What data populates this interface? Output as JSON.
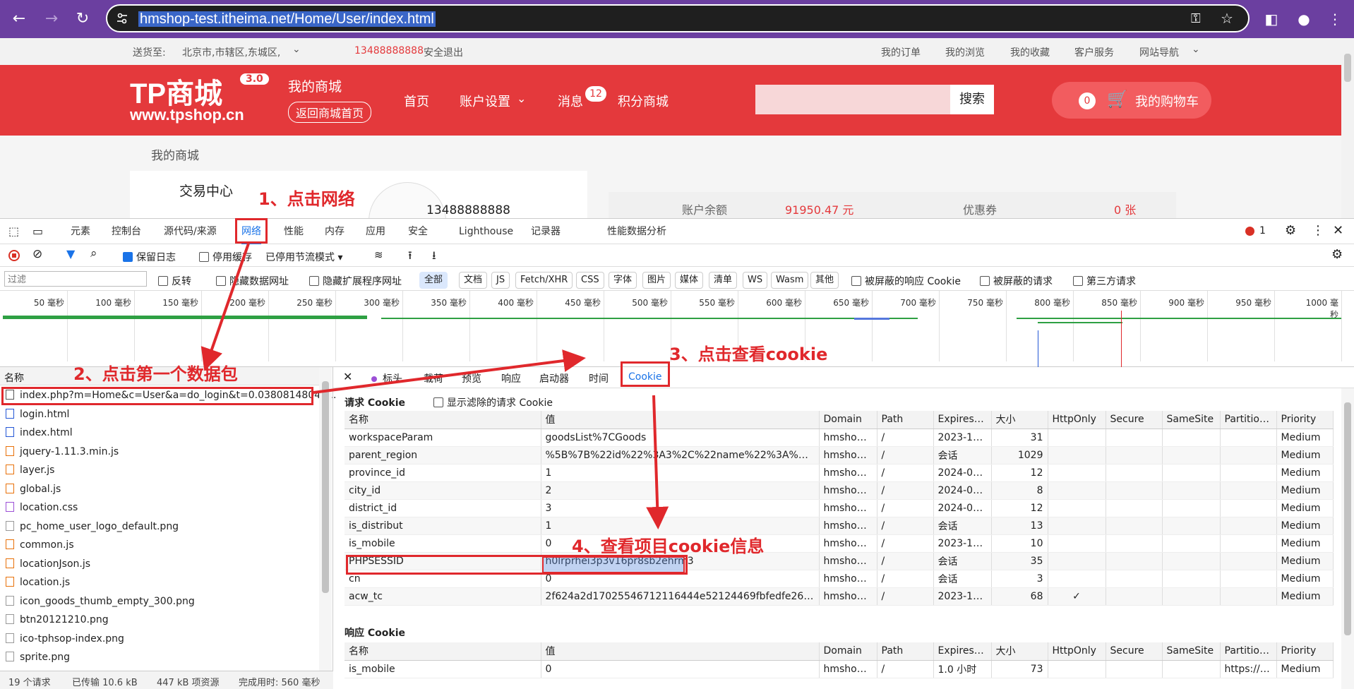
{
  "browser": {
    "url": "hmshop-test.itheima.net/Home/User/index.html"
  },
  "topbar": {
    "ship_to_label": "送货至:",
    "ship_to_value": "北京市,市辖区,东城区,",
    "phone": "13488888888",
    "logout": "安全退出",
    "links": [
      "我的订单",
      "我的浏览",
      "我的收藏",
      "客户服务",
      "网站导航"
    ]
  },
  "header": {
    "logo_text": "TP商城",
    "logo_version": "3.0",
    "logo_url": "www.tpshop.cn",
    "my_mall": "我的商城",
    "back_home": "返回商城首页",
    "nav": [
      "首页",
      "账户设置",
      "消息",
      "积分商城"
    ],
    "msg_badge": "12",
    "search_button": "搜索",
    "cart_count": "0",
    "cart_label": "我的购物车"
  },
  "body": {
    "breadcrumb": "我的商城",
    "trade_center": "交易中心",
    "username": "13488888888",
    "balance_label": "账户余额",
    "balance_value": "91950.47 元",
    "coupon_label": "优惠券",
    "coupon_value": "0 张"
  },
  "devtools": {
    "tabs": [
      "元素",
      "控制台",
      "源代码/来源",
      "网络",
      "性能",
      "内存",
      "应用",
      "安全",
      "Lighthouse",
      "记录器",
      "性能数据分析"
    ],
    "error_count": "1",
    "preserve_log": "保留日志",
    "disable_cache": "停用缓存",
    "throttle": "已停用节流模式",
    "filter_placeholder": "过滤",
    "invert": "反转",
    "hide_data_urls": "隐藏数据网址",
    "hide_ext_urls": "隐藏扩展程序网址",
    "type_filters": [
      "全部",
      "文档",
      "JS",
      "Fetch/XHR",
      "CSS",
      "字体",
      "图片",
      "媒体",
      "清单",
      "WS",
      "Wasm",
      "其他"
    ],
    "blocked_cookies": "被屏蔽的响应 Cookie",
    "blocked_requests": "被屏蔽的请求",
    "third_party": "第三方请求",
    "timeline_ticks": [
      "50 毫秒",
      "100 毫秒",
      "150 毫秒",
      "200 毫秒",
      "250 毫秒",
      "300 毫秒",
      "350 毫秒",
      "400 毫秒",
      "450 毫秒",
      "500 毫秒",
      "550 毫秒",
      "600 毫秒",
      "650 毫秒",
      "700 毫秒",
      "750 毫秒",
      "800 毫秒",
      "850 毫秒",
      "900 毫秒",
      "950 毫秒",
      "1000 毫秒"
    ],
    "name_header": "名称",
    "files": [
      "index.php?m=Home&c=User&a=do_login&t=0.03808148040...",
      "login.html",
      "index.html",
      "jquery-1.11.3.min.js",
      "layer.js",
      "global.js",
      "location.css",
      "pc_home_user_logo_default.png",
      "common.js",
      "locationJson.js",
      "location.js",
      "icon_goods_thumb_empty_300.png",
      "btn20121210.png",
      "ico-tphsop-index.png",
      "sprite.png"
    ],
    "status": {
      "requests": "19 个请求",
      "transferred": "已传输 10.6 kB",
      "resources": "447 kB 项资源",
      "finish": "完成用时: 560 毫秒"
    },
    "detail_tabs": [
      "标头",
      "载荷",
      "预览",
      "响应",
      "启动器",
      "时间",
      "Cookie"
    ],
    "request_cookie_title": "请求 Cookie",
    "show_filtered": "显示滤除的请求 Cookie",
    "response_cookie_title": "响应 Cookie",
    "columns": [
      "名称",
      "值",
      "Domain",
      "Path",
      "Expires /...",
      "大小",
      "HttpOnly",
      "Secure",
      "SameSite",
      "Partition...",
      "Priority"
    ],
    "request_cookies": [
      [
        "workspaceParam",
        "goodsList%7CGoods",
        "hmshop...",
        "/",
        "2023-12...",
        "31",
        "",
        "",
        "",
        "",
        "Medium"
      ],
      [
        "parent_region",
        "%5B%7B%22id%22%3A3%2C%22name%22%3A%22u...",
        "hmshop...",
        "/",
        "会话",
        "1029",
        "",
        "",
        "",
        "",
        "Medium"
      ],
      [
        "province_id",
        "1",
        "hmshop...",
        "/",
        "2024-01...",
        "12",
        "",
        "",
        "",
        "",
        "Medium"
      ],
      [
        "city_id",
        "2",
        "hmshop...",
        "/",
        "2024-01...",
        "8",
        "",
        "",
        "",
        "",
        "Medium"
      ],
      [
        "district_id",
        "3",
        "hmshop...",
        "/",
        "2024-01...",
        "12",
        "",
        "",
        "",
        "",
        "Medium"
      ],
      [
        "is_distribut",
        "1",
        "hmshop...",
        "/",
        "会话",
        "13",
        "",
        "",
        "",
        "",
        "Medium"
      ],
      [
        "is_mobile",
        "0",
        "hmshop...",
        "/",
        "2023-12...",
        "10",
        "",
        "",
        "",
        "",
        "Medium"
      ],
      [
        "PHPSESSID",
        "h0lrprhei3p3v16pr8sb2ehrm3",
        "hmshop...",
        "/",
        "会话",
        "35",
        "",
        "",
        "",
        "",
        "Medium"
      ],
      [
        "cn",
        "0",
        "hmshop...",
        "/",
        "会话",
        "3",
        "",
        "",
        "",
        "",
        "Medium"
      ],
      [
        "acw_tc",
        "2f624a2d17025546712116444e52124469fbfedfe2667f3...",
        "hmshop...",
        "/",
        "2023-12...",
        "68",
        "✓",
        "",
        "",
        "",
        "Medium"
      ]
    ],
    "response_cookies": [
      [
        "is_mobile",
        "0",
        "hmshop...",
        "/",
        "1.0 小时",
        "73",
        "",
        "",
        "",
        "https://it...",
        "Medium"
      ]
    ]
  },
  "annotations": {
    "step1": "1、点击网络",
    "step2": "2、点击第一个数据包",
    "step3": "3、点击查看cookie",
    "step4": "4、查看项目cookie信息"
  }
}
